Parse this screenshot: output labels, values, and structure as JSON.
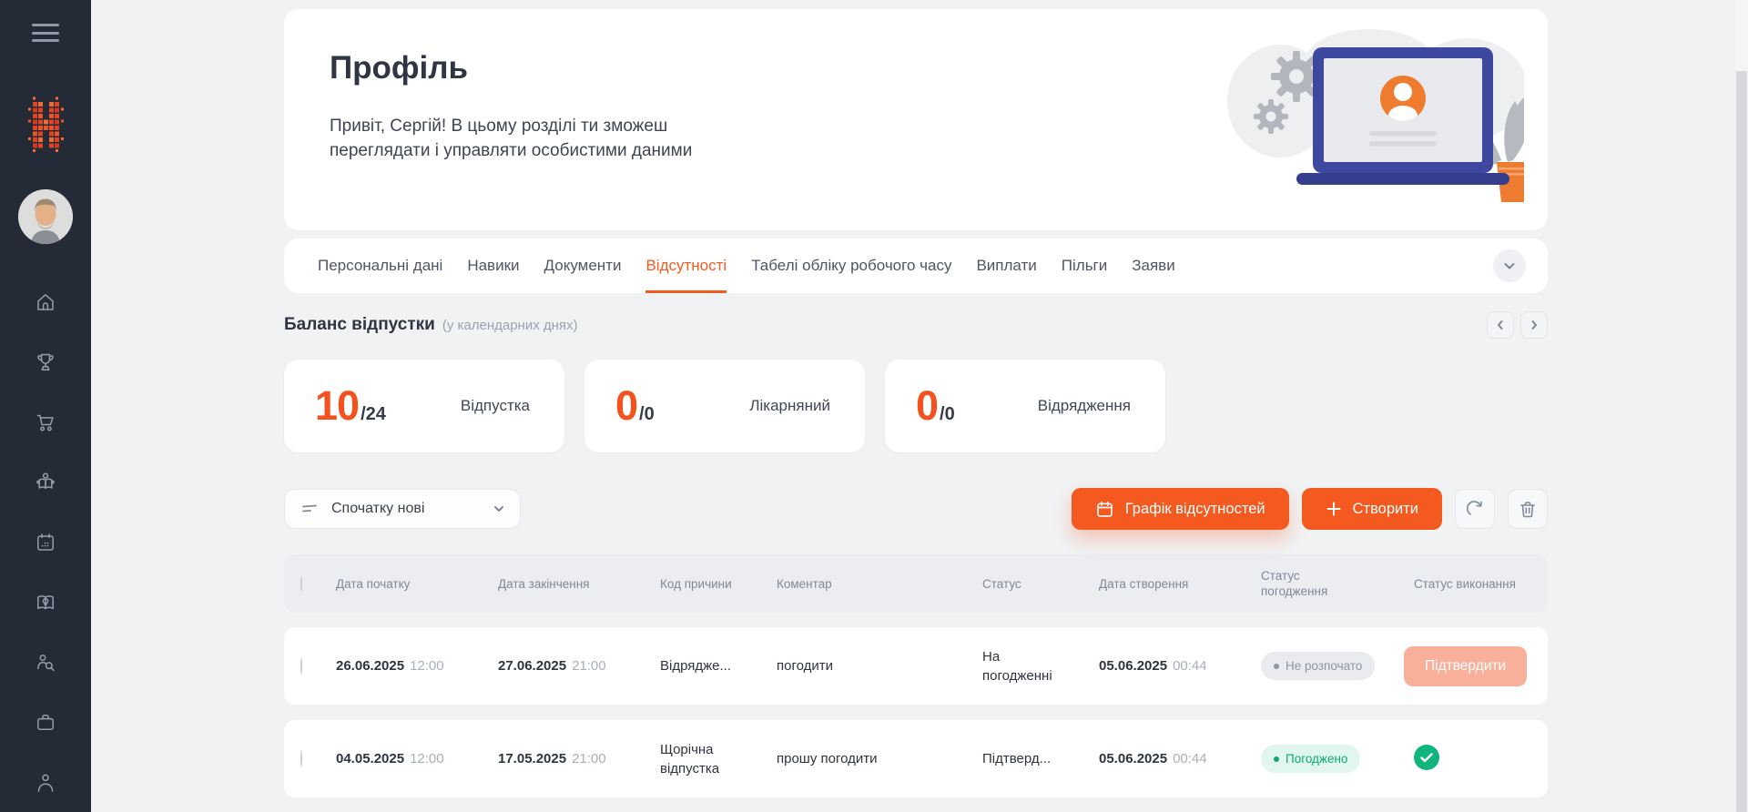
{
  "header": {
    "title": "Профіль",
    "greeting": "Привіт, Сергій! В цьому розділі ти зможеш переглядати і управляти особистими даними"
  },
  "sidebar": {
    "icons": [
      "hamburger-icon",
      "logo",
      "user-avatar",
      "home-icon",
      "trophy-icon",
      "cart-icon",
      "training-icon",
      "calendar-icon",
      "knowledge-icon",
      "recruiting-icon",
      "briefcase-icon",
      "profile-icon"
    ]
  },
  "tabs": {
    "items": [
      {
        "label": "Персональні дані",
        "active": false
      },
      {
        "label": "Навики",
        "active": false
      },
      {
        "label": "Документи",
        "active": false
      },
      {
        "label": "Відсутності",
        "active": true
      },
      {
        "label": "Табелі обліку робочого часу",
        "active": false
      },
      {
        "label": "Виплати",
        "active": false
      },
      {
        "label": "Пільги",
        "active": false
      },
      {
        "label": "Заяви",
        "active": false
      }
    ]
  },
  "balance": {
    "title": "Баланс відпустки",
    "note": "(у календарних днях)",
    "cards": [
      {
        "used": "10",
        "total": "/24",
        "label": "Відпустка"
      },
      {
        "used": "0",
        "total": "/0",
        "label": "Лікарняний"
      },
      {
        "used": "0",
        "total": "/0",
        "label": "Відрядження"
      }
    ]
  },
  "toolbar": {
    "sort_label": "Спочатку нові",
    "schedule_label": "Графік відсутностей",
    "create_label": "Створити"
  },
  "table": {
    "columns": [
      "Дата початку",
      "Дата закінчення",
      "Код причини",
      "Коментар",
      "Статус",
      "Дата створення",
      "Статус погодження",
      "Статус виконання"
    ],
    "rows": [
      {
        "start_date": "26.06.2025",
        "start_time": "12:00",
        "end_date": "27.06.2025",
        "end_time": "21:00",
        "reason": "Відрядже...",
        "comment": "погодити",
        "status": "На погодженні",
        "created_date": "05.06.2025",
        "created_time": "00:44",
        "approval": "Не розпочато",
        "action_label": "Підтвердити"
      },
      {
        "start_date": "04.05.2025",
        "start_time": "12:00",
        "end_date": "17.05.2025",
        "end_time": "21:00",
        "reason": "Щорічна відпустка",
        "comment": "прошу погодити",
        "status": "Підтверд...",
        "created_date": "05.06.2025",
        "created_time": "00:44",
        "approval": "Погоджено",
        "execution": "approved-check"
      }
    ]
  },
  "colors": {
    "accent_orange": "#f4591f",
    "number_orange": "#f4511e",
    "confirm_salmon": "#f9b09a",
    "success_green": "#10b57d",
    "sidebar_dark": "#252b36",
    "page_bg": "#f1f2f4"
  }
}
